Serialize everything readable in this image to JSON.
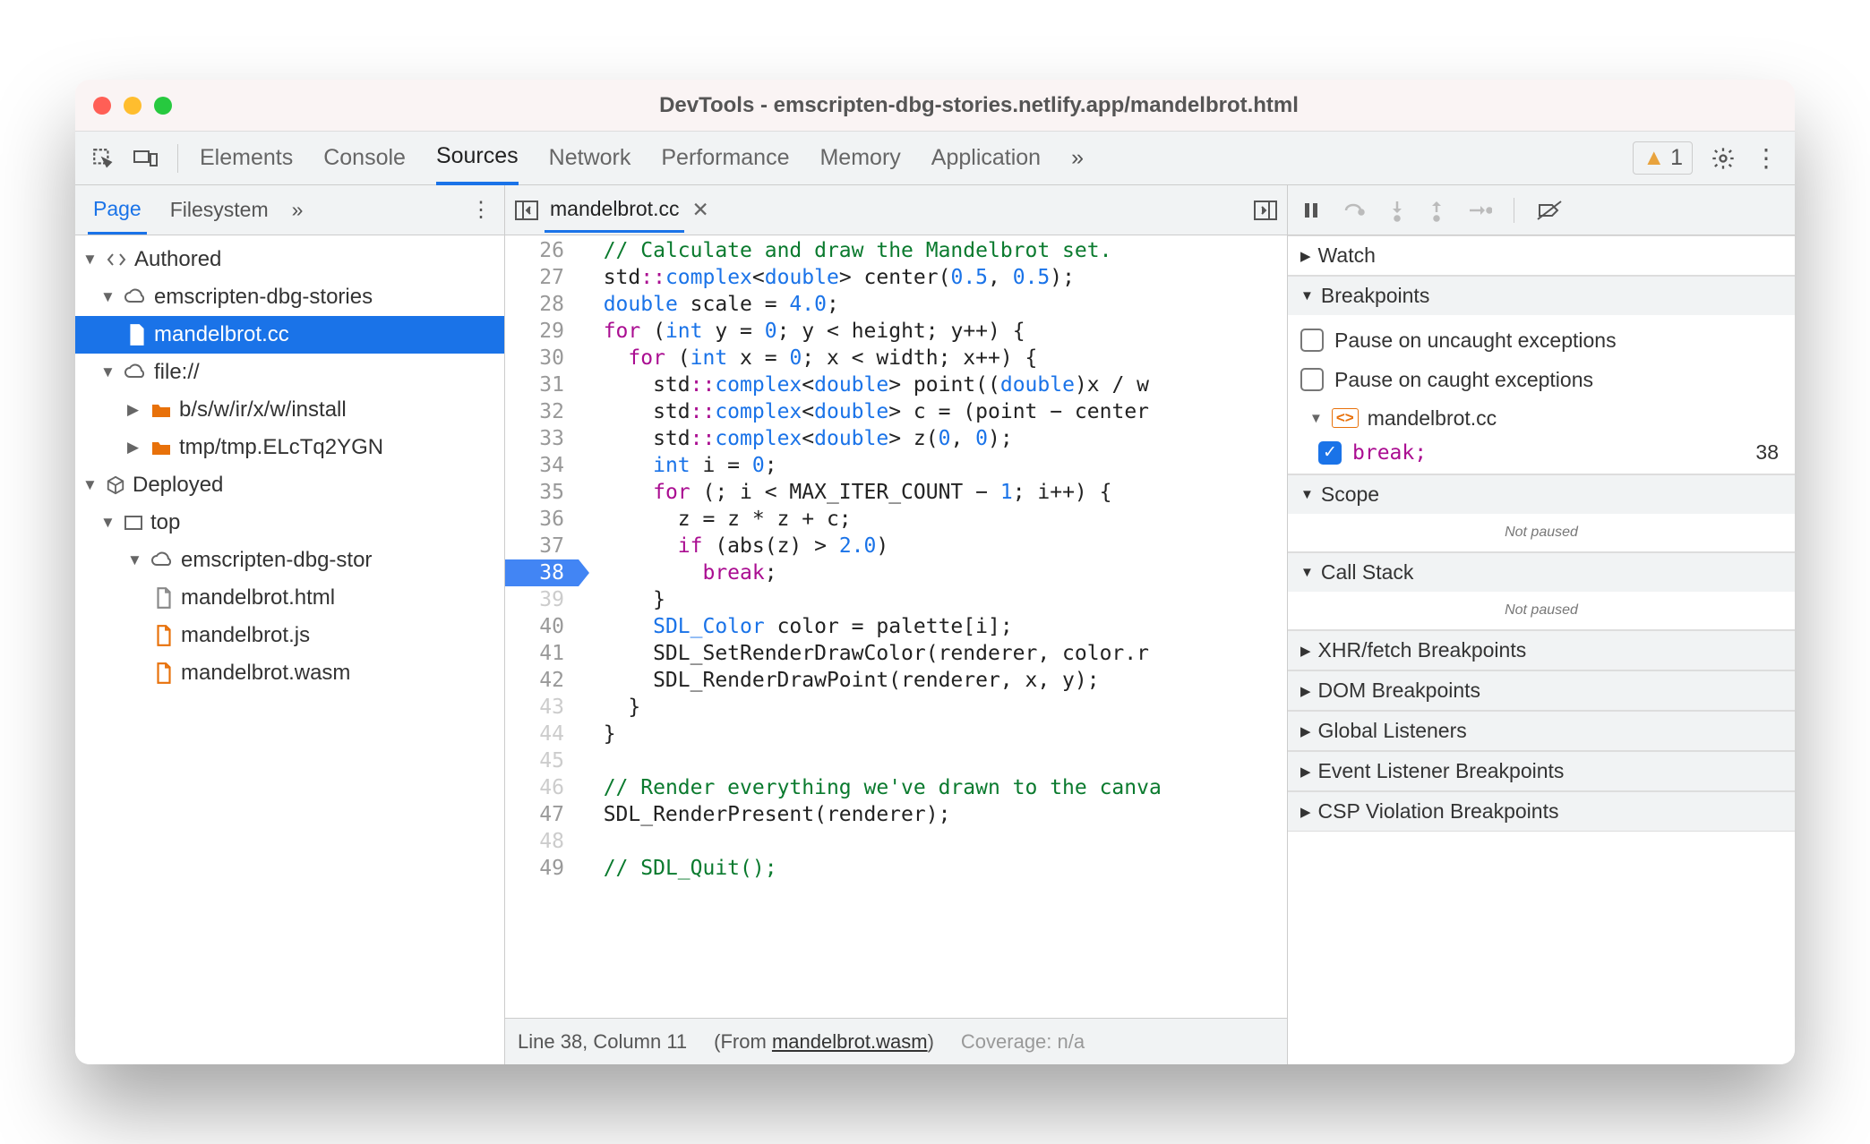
{
  "window_title": "DevTools - emscripten-dbg-stories.netlify.app/mandelbrot.html",
  "tabs": [
    "Elements",
    "Console",
    "Sources",
    "Network",
    "Performance",
    "Memory",
    "Application"
  ],
  "active_tab": "Sources",
  "warnings_count": "1",
  "left_tabs": [
    "Page",
    "Filesystem"
  ],
  "tree": {
    "authored": "Authored",
    "domain1": "emscripten-dbg-stories",
    "file_cc": "mandelbrot.cc",
    "file_proto": "file://",
    "folder1": "b/s/w/ir/x/w/install",
    "folder2": "tmp/tmp.ELcTq2YGN",
    "deployed": "Deployed",
    "top": "top",
    "domain2": "emscripten-dbg-stor",
    "file_html": "mandelbrot.html",
    "file_js": "mandelbrot.js",
    "file_wasm": "mandelbrot.wasm"
  },
  "editor": {
    "filename": "mandelbrot.cc",
    "line_start": 26,
    "breakpoint_line": 38,
    "dimmed_lines": [
      39,
      43,
      44,
      45,
      46,
      48
    ],
    "lines": [
      {
        "n": 26,
        "html": "  <span class='c-com'>// Calculate and draw the Mandelbrot set.</span>"
      },
      {
        "n": 27,
        "html": "  std<span class='c-op'>::</span><span class='c-type'>complex</span>&lt;<span class='c-type'>double</span>&gt; center(<span class='c-num'>0.5</span>, <span class='c-num'>0.5</span>);"
      },
      {
        "n": 28,
        "html": "  <span class='c-type'>double</span> scale = <span class='c-num'>4.0</span>;"
      },
      {
        "n": 29,
        "html": "  <span class='c-kw'>for</span> (<span class='c-type'>int</span> y = <span class='c-num'>0</span>; y &lt; height; y++) {"
      },
      {
        "n": 30,
        "html": "    <span class='c-kw'>for</span> (<span class='c-type'>int</span> x = <span class='c-num'>0</span>; x &lt; width; x++) {"
      },
      {
        "n": 31,
        "html": "      std<span class='c-op'>::</span><span class='c-type'>complex</span>&lt;<span class='c-type'>double</span>&gt; point((<span class='c-type'>double</span>)x / w"
      },
      {
        "n": 32,
        "html": "      std<span class='c-op'>::</span><span class='c-type'>complex</span>&lt;<span class='c-type'>double</span>&gt; c = (point − center"
      },
      {
        "n": 33,
        "html": "      std<span class='c-op'>::</span><span class='c-type'>complex</span>&lt;<span class='c-type'>double</span>&gt; z(<span class='c-num'>0</span>, <span class='c-num'>0</span>);"
      },
      {
        "n": 34,
        "html": "      <span class='c-type'>int</span> i = <span class='c-num'>0</span>;"
      },
      {
        "n": 35,
        "html": "      <span class='c-kw'>for</span> (; i &lt; MAX_ITER_COUNT − <span class='c-num'>1</span>; i++) {"
      },
      {
        "n": 36,
        "html": "        z = z * z + c;"
      },
      {
        "n": 37,
        "html": "        <span class='c-kw'>if</span> (abs(z) &gt; <span class='c-num'>2.0</span>)"
      },
      {
        "n": 38,
        "html": "          <span class='c-kw'>break</span>;"
      },
      {
        "n": 39,
        "html": "      }"
      },
      {
        "n": 40,
        "html": "      <span class='c-type'>SDL_Color</span> color = palette[i];"
      },
      {
        "n": 41,
        "html": "      SDL_SetRenderDrawColor(renderer, color.r"
      },
      {
        "n": 42,
        "html": "      SDL_RenderDrawPoint(renderer, x, y);"
      },
      {
        "n": 43,
        "html": "    }"
      },
      {
        "n": 44,
        "html": "  }"
      },
      {
        "n": 45,
        "html": ""
      },
      {
        "n": 46,
        "html": "  <span class='c-com'>// Render everything we've drawn to the canva</span>"
      },
      {
        "n": 47,
        "html": "  SDL_RenderPresent(renderer);"
      },
      {
        "n": 48,
        "html": ""
      },
      {
        "n": 49,
        "html": "  <span class='c-com'>// SDL_Quit();</span>"
      }
    ]
  },
  "status": {
    "position": "Line 38, Column 11",
    "from_prefix": "(From ",
    "from_link": "mandelbrot.wasm",
    "from_suffix": ")",
    "coverage": "Coverage: n/a"
  },
  "right": {
    "watch": "Watch",
    "breakpoints": "Breakpoints",
    "pause_uncaught": "Pause on uncaught exceptions",
    "pause_caught": "Pause on caught exceptions",
    "bp_file": "mandelbrot.cc",
    "bp_text": "break;",
    "bp_line": "38",
    "scope": "Scope",
    "not_paused": "Not paused",
    "callstack": "Call Stack",
    "xhr": "XHR/fetch Breakpoints",
    "dom": "DOM Breakpoints",
    "global": "Global Listeners",
    "event": "Event Listener Breakpoints",
    "csp": "CSP Violation Breakpoints"
  }
}
